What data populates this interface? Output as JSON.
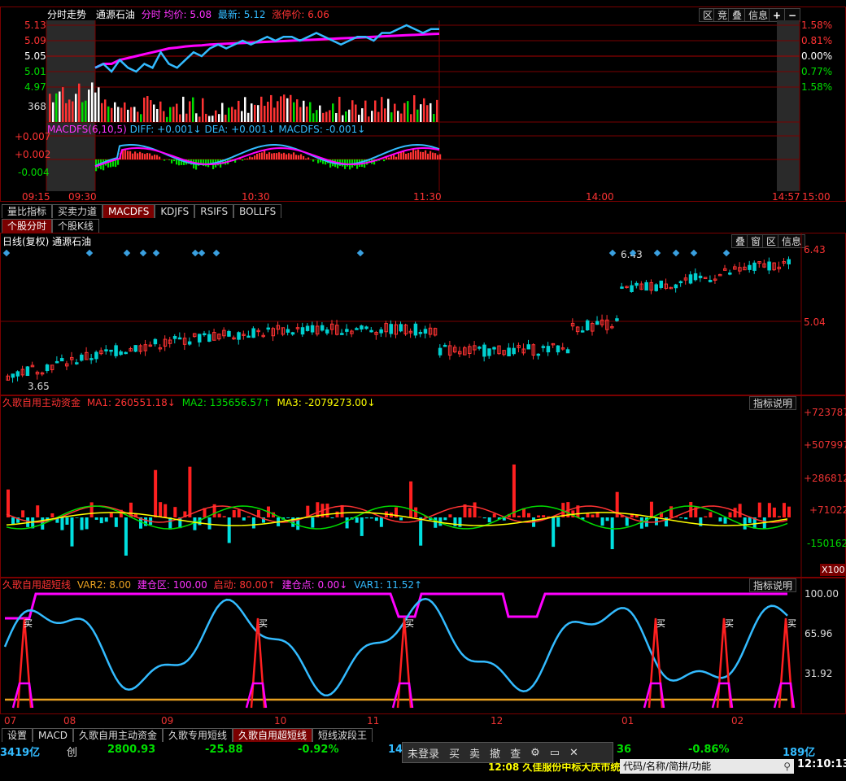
{
  "intraday": {
    "title": "分时走势",
    "stock": "通源石油",
    "avg_label": "分时 均价:",
    "avg_value": "5.08",
    "last_label": "最新:",
    "last_value": "5.12",
    "limit_label": "涨停价:",
    "limit_value": "6.06",
    "buttons": [
      "区",
      "竞",
      "叠",
      "信息",
      "+",
      "−"
    ],
    "price_ticks": [
      "5.13",
      "5.09",
      "5.05",
      "5.01",
      "4.97"
    ],
    "pct_ticks": [
      "1.58%",
      "0.81%",
      "0.00%",
      "0.77%",
      "1.58%"
    ],
    "volume_tick": "368",
    "macd_label": "MACDFS(6,10,5)",
    "macd_diff": "DIFF: +0.001↓",
    "macd_dea": "DEA: +0.001↓",
    "macd_val": "MACDFS: -0.001↓",
    "macd_ticks": [
      "+0.007",
      "+0.002",
      "-0.004"
    ],
    "time_ticks": [
      "09:15",
      "09:30",
      "10:30",
      "11:30",
      "14:00",
      "14:57",
      "15:00"
    ],
    "avg_price": 5.08,
    "last_price": 5.12,
    "price_series": [
      5.02,
      5.03,
      5.01,
      5.04,
      5.02,
      5.01,
      5.03,
      5.02,
      5.06,
      5.03,
      5.02,
      5.04,
      5.06,
      5.05,
      5.07,
      5.08,
      5.07,
      5.08,
      5.09,
      5.08,
      5.09,
      5.1,
      5.09,
      5.1,
      5.1,
      5.09,
      5.1,
      5.11,
      5.1,
      5.09,
      5.08,
      5.09,
      5.1,
      5.1,
      5.09,
      5.11,
      5.11,
      5.12,
      5.13,
      5.12,
      5.11,
      5.12,
      5.12
    ],
    "avg_series": [
      5.02,
      5.03,
      5.03,
      5.04,
      5.045,
      5.05,
      5.055,
      5.06,
      5.065,
      5.07,
      5.072,
      5.075,
      5.077,
      5.078,
      5.08,
      5.081,
      5.082,
      5.083,
      5.084,
      5.085,
      5.086,
      5.087,
      5.088,
      5.089,
      5.09,
      5.091,
      5.092,
      5.093,
      5.094,
      5.095,
      5.096,
      5.097,
      5.098,
      5.099,
      5.1,
      5.101,
      5.102,
      5.103,
      5.104,
      5.105,
      5.106,
      5.107,
      5.108
    ]
  },
  "tabs_row1": [
    "量比指标",
    "买卖力道",
    "MACDFS",
    "KDJFS",
    "RSIFS",
    "BOLLFS"
  ],
  "tabs_row2": [
    "个股分时",
    "个股K线"
  ],
  "daily": {
    "title": "日线(复权) 通源石油",
    "buttons": [
      "叠",
      "窗",
      "区",
      "信息"
    ],
    "high_tick": "6.43",
    "mid_tick": "5.04",
    "high_label": "6.43",
    "low_label": "3.65"
  },
  "fund": {
    "title": "久歌自用主动资金",
    "ma1": "MA1: 260551.18↓",
    "ma2": "MA2: 135656.57↑",
    "ma3": "MA3: -2079273.00↓",
    "help": "指标说明",
    "ticks": [
      "+723787",
      "+507997",
      "+286812",
      "+71022",
      "-150162"
    ],
    "unit": "X100"
  },
  "short": {
    "title": "久歌自用超短线",
    "var2": "VAR2: 8.00",
    "zone": "建仓区: 100.00",
    "start": "启动: 80.00↑",
    "point": "建仓点: 0.00↓",
    "var1": "VAR1: 11.52↑",
    "help": "指标说明",
    "ticks": [
      "100.00",
      "65.96",
      "31.92"
    ],
    "buy": "买"
  },
  "months": [
    "07",
    "08",
    "09",
    "10",
    "11",
    "12",
    "01",
    "02"
  ],
  "bottom_tabs": [
    "设置",
    "MACD",
    "久歌自用主动资金",
    "久歌专用短线",
    "久歌自用超短线",
    "短线波段王"
  ],
  "status": {
    "turnover": "3419亿",
    "board": "创",
    "index": "2800.93",
    "change": "-25.88",
    "pct": "-0.92%",
    "t1": "14",
    "t2": "36",
    "pct2": "-0.86%",
    "amt2": "189亿",
    "ticker": "12:08 久佳服份中标大庆市统",
    "search_placeholder": "代码/名称/简拼/功能",
    "clock": "12:10:13"
  },
  "float_toolbar": [
    "未登录",
    "买",
    "卖",
    "撤",
    "查",
    "gear-icon",
    "window-icon",
    "close-icon"
  ],
  "colors": {
    "up": "#ff3333",
    "down": "#00c0c0",
    "avg": "#ff00ff",
    "price": "#33bbff",
    "border": "#7a0000",
    "green": "#00dd00",
    "yellow": "#ffff00",
    "orange": "#e8a020"
  }
}
